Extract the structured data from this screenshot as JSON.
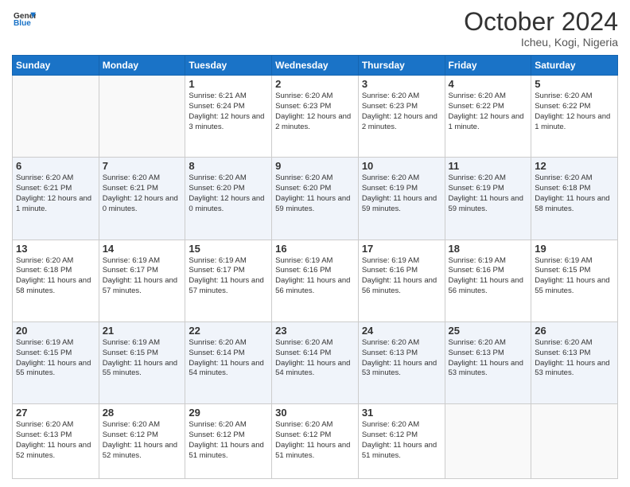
{
  "header": {
    "logo_line1": "General",
    "logo_line2": "Blue",
    "month": "October 2024",
    "location": "Icheu, Kogi, Nigeria"
  },
  "weekdays": [
    "Sunday",
    "Monday",
    "Tuesday",
    "Wednesday",
    "Thursday",
    "Friday",
    "Saturday"
  ],
  "weeks": [
    [
      {
        "day": "",
        "info": ""
      },
      {
        "day": "",
        "info": ""
      },
      {
        "day": "1",
        "info": "Sunrise: 6:21 AM\nSunset: 6:24 PM\nDaylight: 12 hours and 3 minutes."
      },
      {
        "day": "2",
        "info": "Sunrise: 6:20 AM\nSunset: 6:23 PM\nDaylight: 12 hours and 2 minutes."
      },
      {
        "day": "3",
        "info": "Sunrise: 6:20 AM\nSunset: 6:23 PM\nDaylight: 12 hours and 2 minutes."
      },
      {
        "day": "4",
        "info": "Sunrise: 6:20 AM\nSunset: 6:22 PM\nDaylight: 12 hours and 1 minute."
      },
      {
        "day": "5",
        "info": "Sunrise: 6:20 AM\nSunset: 6:22 PM\nDaylight: 12 hours and 1 minute."
      }
    ],
    [
      {
        "day": "6",
        "info": "Sunrise: 6:20 AM\nSunset: 6:21 PM\nDaylight: 12 hours and 1 minute."
      },
      {
        "day": "7",
        "info": "Sunrise: 6:20 AM\nSunset: 6:21 PM\nDaylight: 12 hours and 0 minutes."
      },
      {
        "day": "8",
        "info": "Sunrise: 6:20 AM\nSunset: 6:20 PM\nDaylight: 12 hours and 0 minutes."
      },
      {
        "day": "9",
        "info": "Sunrise: 6:20 AM\nSunset: 6:20 PM\nDaylight: 11 hours and 59 minutes."
      },
      {
        "day": "10",
        "info": "Sunrise: 6:20 AM\nSunset: 6:19 PM\nDaylight: 11 hours and 59 minutes."
      },
      {
        "day": "11",
        "info": "Sunrise: 6:20 AM\nSunset: 6:19 PM\nDaylight: 11 hours and 59 minutes."
      },
      {
        "day": "12",
        "info": "Sunrise: 6:20 AM\nSunset: 6:18 PM\nDaylight: 11 hours and 58 minutes."
      }
    ],
    [
      {
        "day": "13",
        "info": "Sunrise: 6:20 AM\nSunset: 6:18 PM\nDaylight: 11 hours and 58 minutes."
      },
      {
        "day": "14",
        "info": "Sunrise: 6:19 AM\nSunset: 6:17 PM\nDaylight: 11 hours and 57 minutes."
      },
      {
        "day": "15",
        "info": "Sunrise: 6:19 AM\nSunset: 6:17 PM\nDaylight: 11 hours and 57 minutes."
      },
      {
        "day": "16",
        "info": "Sunrise: 6:19 AM\nSunset: 6:16 PM\nDaylight: 11 hours and 56 minutes."
      },
      {
        "day": "17",
        "info": "Sunrise: 6:19 AM\nSunset: 6:16 PM\nDaylight: 11 hours and 56 minutes."
      },
      {
        "day": "18",
        "info": "Sunrise: 6:19 AM\nSunset: 6:16 PM\nDaylight: 11 hours and 56 minutes."
      },
      {
        "day": "19",
        "info": "Sunrise: 6:19 AM\nSunset: 6:15 PM\nDaylight: 11 hours and 55 minutes."
      }
    ],
    [
      {
        "day": "20",
        "info": "Sunrise: 6:19 AM\nSunset: 6:15 PM\nDaylight: 11 hours and 55 minutes."
      },
      {
        "day": "21",
        "info": "Sunrise: 6:19 AM\nSunset: 6:15 PM\nDaylight: 11 hours and 55 minutes."
      },
      {
        "day": "22",
        "info": "Sunrise: 6:20 AM\nSunset: 6:14 PM\nDaylight: 11 hours and 54 minutes."
      },
      {
        "day": "23",
        "info": "Sunrise: 6:20 AM\nSunset: 6:14 PM\nDaylight: 11 hours and 54 minutes."
      },
      {
        "day": "24",
        "info": "Sunrise: 6:20 AM\nSunset: 6:13 PM\nDaylight: 11 hours and 53 minutes."
      },
      {
        "day": "25",
        "info": "Sunrise: 6:20 AM\nSunset: 6:13 PM\nDaylight: 11 hours and 53 minutes."
      },
      {
        "day": "26",
        "info": "Sunrise: 6:20 AM\nSunset: 6:13 PM\nDaylight: 11 hours and 53 minutes."
      }
    ],
    [
      {
        "day": "27",
        "info": "Sunrise: 6:20 AM\nSunset: 6:13 PM\nDaylight: 11 hours and 52 minutes."
      },
      {
        "day": "28",
        "info": "Sunrise: 6:20 AM\nSunset: 6:12 PM\nDaylight: 11 hours and 52 minutes."
      },
      {
        "day": "29",
        "info": "Sunrise: 6:20 AM\nSunset: 6:12 PM\nDaylight: 11 hours and 51 minutes."
      },
      {
        "day": "30",
        "info": "Sunrise: 6:20 AM\nSunset: 6:12 PM\nDaylight: 11 hours and 51 minutes."
      },
      {
        "day": "31",
        "info": "Sunrise: 6:20 AM\nSunset: 6:12 PM\nDaylight: 11 hours and 51 minutes."
      },
      {
        "day": "",
        "info": ""
      },
      {
        "day": "",
        "info": ""
      }
    ]
  ]
}
